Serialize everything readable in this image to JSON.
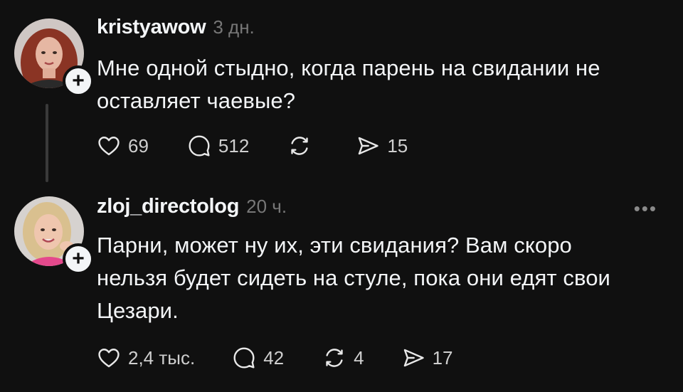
{
  "posts": [
    {
      "username": "kristyawow",
      "time": "3 дн.",
      "text_lines": [
        "Мне одной стыдно, когда парень на свидании не",
        "оставляет чаевые?"
      ],
      "likes": "69",
      "replies": "512",
      "reposts": "",
      "shares": "15",
      "avatar_icon": "avatar-woman-red-hair",
      "follow_icon": "plus-icon"
    },
    {
      "username": "zloj_directolog",
      "time": "20 ч.",
      "text_lines": [
        "Парни, может ну их, эти свидания? Вам скоро",
        "нельзя будет сидеть на стуле, пока они едят свои",
        "Цезари."
      ],
      "likes": "2,4 тыс.",
      "replies": "42",
      "reposts": "4",
      "shares": "17",
      "more_label": "•••",
      "avatar_icon": "avatar-woman-blonde",
      "follow_icon": "plus-icon"
    }
  ],
  "colors": {
    "background": "#101010",
    "text": "#f3f5f7",
    "muted": "#777777",
    "thread_line": "#3a3a3a"
  }
}
